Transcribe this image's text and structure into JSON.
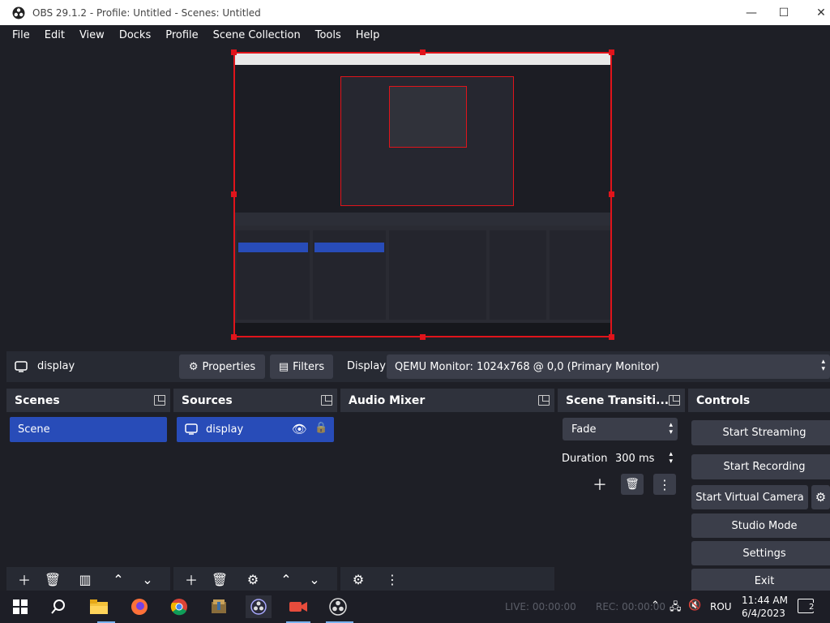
{
  "window": {
    "title": "OBS 29.1.2 - Profile: Untitled - Scenes: Untitled"
  },
  "menu": [
    "File",
    "Edit",
    "View",
    "Docks",
    "Profile",
    "Scene Collection",
    "Tools",
    "Help"
  ],
  "source_toolbar": {
    "source_name": "display",
    "properties_label": "Properties",
    "filters_label": "Filters",
    "display_label": "Display",
    "display_value": "QEMU Monitor: 1024x768 @ 0,0 (Primary Monitor)"
  },
  "docks": {
    "scenes": {
      "title": "Scenes",
      "items": [
        "Scene"
      ]
    },
    "sources": {
      "title": "Sources",
      "items": [
        "display"
      ]
    },
    "audio_mixer": {
      "title": "Audio Mixer"
    },
    "transitions": {
      "title": "Scene Transiti...",
      "transition_value": "Fade",
      "duration_label": "Duration",
      "duration_value": "300 ms"
    },
    "controls": {
      "title": "Controls",
      "start_streaming": "Start Streaming",
      "start_recording": "Start Recording",
      "start_virtual_camera": "Start Virtual Camera",
      "studio_mode": "Studio Mode",
      "settings": "Settings",
      "exit": "Exit"
    }
  },
  "status": {
    "live": "LIVE: 00:00:00",
    "rec": "REC: 00:00:00"
  },
  "taskbar": {
    "language": "ROU",
    "time": "11:44 AM",
    "date": "6/4/2023",
    "notification_count": "2"
  },
  "colors": {
    "selection": "#284cb8",
    "preview_border": "#e0141b"
  }
}
